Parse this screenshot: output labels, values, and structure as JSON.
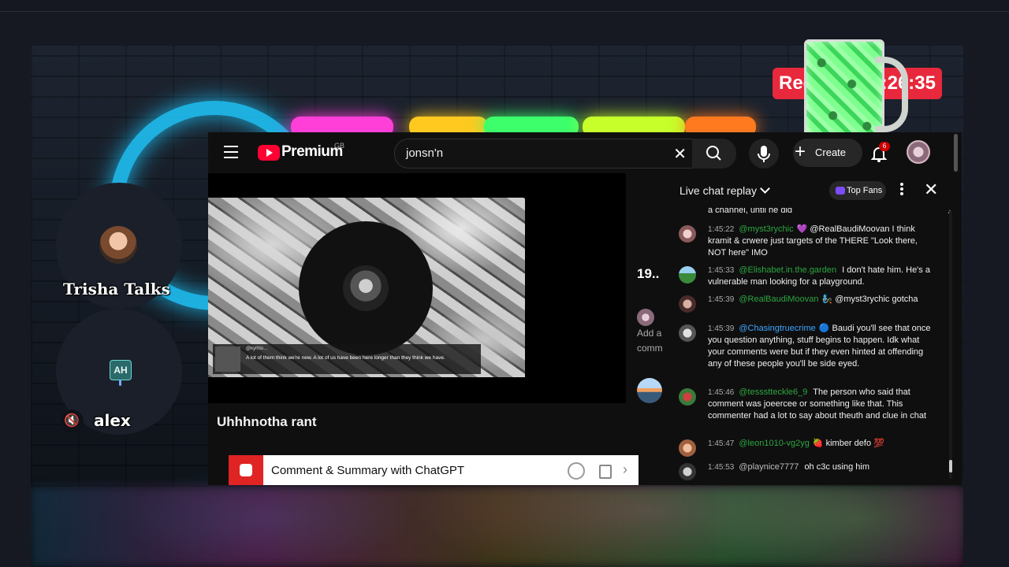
{
  "stream": {
    "rec_label": "Rec",
    "rec_time": "4:26:35",
    "participants": [
      {
        "name": "Trisha Talks"
      },
      {
        "name": "alex",
        "avatar_initials": "AH",
        "mic": "muted"
      }
    ]
  },
  "youtube": {
    "brand": "Premium",
    "country_code": "GB",
    "search": {
      "value": "jonsn'n"
    },
    "create_label": "Create",
    "notification_count": "6",
    "video": {
      "caption_user": "@kyrhlo…",
      "caption_text": "A lot of them think we're new. A lot of us have been here longer than they think we have.",
      "title": "Uhhhnotha rant"
    },
    "chatgpt_bar_label": "Comment & Summary with ChatGPT",
    "related": {
      "count": "19..",
      "text_line1": "Add a",
      "text_line2": "comm"
    },
    "chat": {
      "title": "Live chat replay",
      "top_fans": "Top Fans",
      "messages": [
        {
          "time": "",
          "author": "",
          "text": "a channel, until he did"
        },
        {
          "time": "1:45:22",
          "author": "@myst3rychic",
          "emoji": "💜",
          "text": "@RealBaudiMoovan I think kramit & crwere just targets of the THERE \"Look there, NOT here\" IMO"
        },
        {
          "time": "1:45:33",
          "author": "@Elishabet.in.the.garden",
          "text": "I don't hate him. He's a vulnerable man looking for a playground."
        },
        {
          "time": "1:45:39",
          "author": "@RealBaudiMoovan",
          "emoji": "🧞",
          "text": "@myst3rychic gotcha"
        },
        {
          "time": "1:45:39",
          "author": "@Chasingtruecrime",
          "emoji": "🔵",
          "text": "Baudi you'll see that once you question anything, stuff begins to happen. Idk what your comments were but if they even hinted at offending any of these people you'll be side eyed."
        },
        {
          "time": "1:45:46",
          "author": "@tessstteckle6_9",
          "text": "The person who said that comment was joeercee or something like that. This commenter had a lot to say about theuth and clue in chat"
        },
        {
          "time": "1:45:47",
          "author": "@leon1010-vg2yg",
          "emoji": "🍓",
          "text": "kimber defo 💯"
        },
        {
          "time": "1:45:53",
          "author": "@playnice7777",
          "text": "oh c3c using him"
        }
      ]
    }
  },
  "colors": {
    "accent": "#ff0033",
    "rec": "#e8283c",
    "author_green": "#2ba640",
    "author_blue": "#3ea6ff"
  }
}
